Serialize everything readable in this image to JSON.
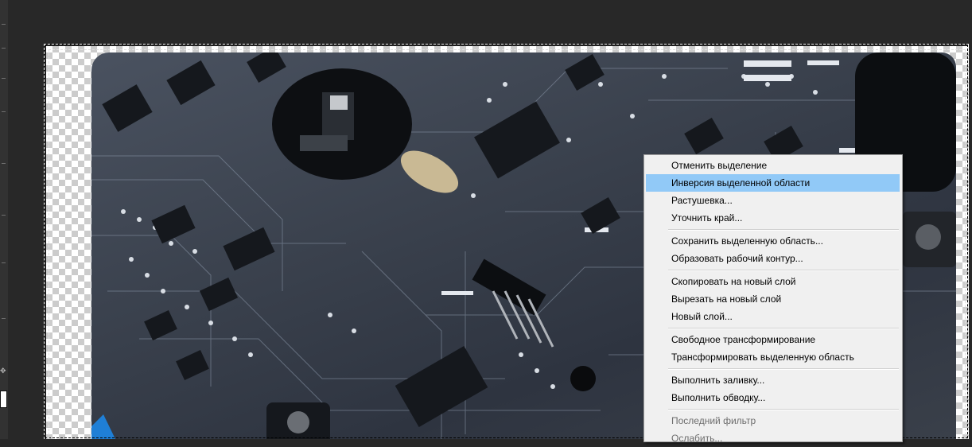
{
  "toolbar": {
    "icon": "move-tool-icon",
    "foreground_color": "#ffffff",
    "background_color": "#323232"
  },
  "canvas": {
    "background_pattern": "transparency-checkerboard",
    "image_icon": "circuit-board-photo"
  },
  "context_menu": {
    "groups": [
      [
        "Отменить выделение",
        "Инверсия выделенной области",
        "Растушевка...",
        "Уточнить край..."
      ],
      [
        "Сохранить выделенную область...",
        "Образовать рабочий контур..."
      ],
      [
        "Скопировать на новый слой",
        "Вырезать на новый слой",
        "Новый слой..."
      ],
      [
        "Свободное трансформирование",
        "Трансформировать выделенную область"
      ],
      [
        "Выполнить заливку...",
        "Выполнить обводку..."
      ],
      [
        "Последний фильтр",
        "Ослабить..."
      ]
    ],
    "highlighted_item": "Инверсия выделенной области",
    "disabled_items": [
      "Последний фильтр",
      "Ослабить..."
    ],
    "highlight_color": "#91c9f7",
    "background_color": "#f0f0f0"
  }
}
